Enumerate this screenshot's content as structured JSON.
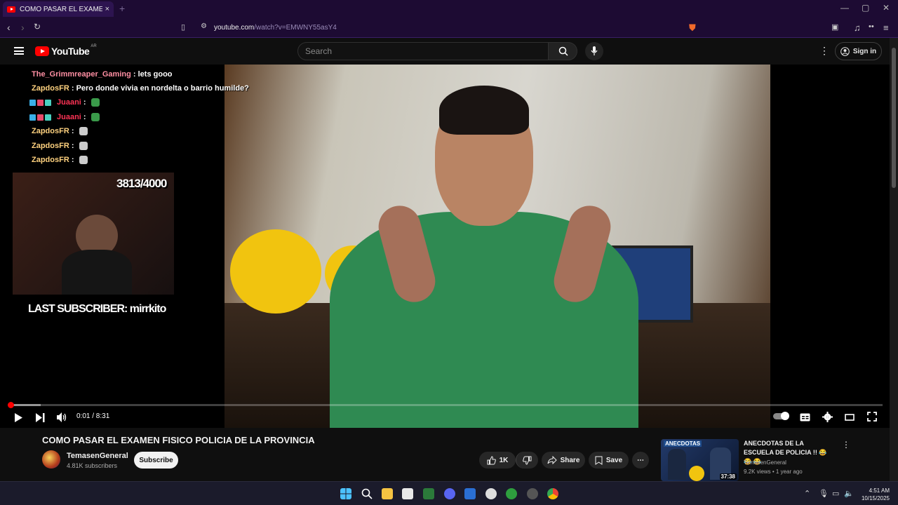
{
  "browser": {
    "tab_title": "COMO PASAR EL EXAMEN FISICO",
    "tab_close": "×",
    "new_tab": "+",
    "url_host": "youtube.com",
    "url_path": "/watch?v=EMWNY55asY4",
    "window_controls": [
      "—",
      "▢",
      "✕"
    ]
  },
  "youtube": {
    "logo_text": "YouTube",
    "country_code": "AR",
    "search_placeholder": "Search",
    "signin_label": "Sign in",
    "brand_color": "#ff0000"
  },
  "overlay": {
    "chat": [
      {
        "user": "The_Grimmreaper_Gaming",
        "sep": " : ",
        "message": "lets gooo"
      },
      {
        "user": "ZapdosFR",
        "sep": " : ",
        "message": "Pero donde vivia en nordelta o barrio humilde?"
      },
      {
        "user": "Juaani",
        "sep": " : ",
        "message": ""
      },
      {
        "user": "Juaani",
        "sep": " : ",
        "message": ""
      },
      {
        "user": "ZapdosFR",
        "sep": " : ",
        "message": ""
      },
      {
        "user": "ZapdosFR",
        "sep": " : ",
        "message": ""
      },
      {
        "user": "ZapdosFR",
        "sep": " : ",
        "message": ""
      }
    ],
    "counter": "3813/4000",
    "last_subscriber": "LAST SUBSCRIBER: mirrkito"
  },
  "player": {
    "time": "0:01 / 8:31",
    "progress_fraction": 0.002,
    "buffered_fraction": 0.037
  },
  "video": {
    "title": "COMO PASAR EL EXAMEN FISICO POLICIA DE LA PROVINCIA",
    "channel": "TemasenGeneral",
    "subscribers": "4.81K subscribers",
    "subscribe_label": "Subscribe",
    "likes": "1K",
    "share_label": "Share",
    "save_label": "Save"
  },
  "related": [
    {
      "title": "ANECDOTAS DE LA ESCUELA DE POLICIA !! 😂 😂 😂",
      "thumb_tag": "ANECDOTAS",
      "channel": "TemasenGeneral",
      "meta": "9.2K views • 1 year ago",
      "duration": "37:38"
    }
  ],
  "taskbar": {
    "time": "4:51 AM",
    "date": "10/15/2025"
  }
}
